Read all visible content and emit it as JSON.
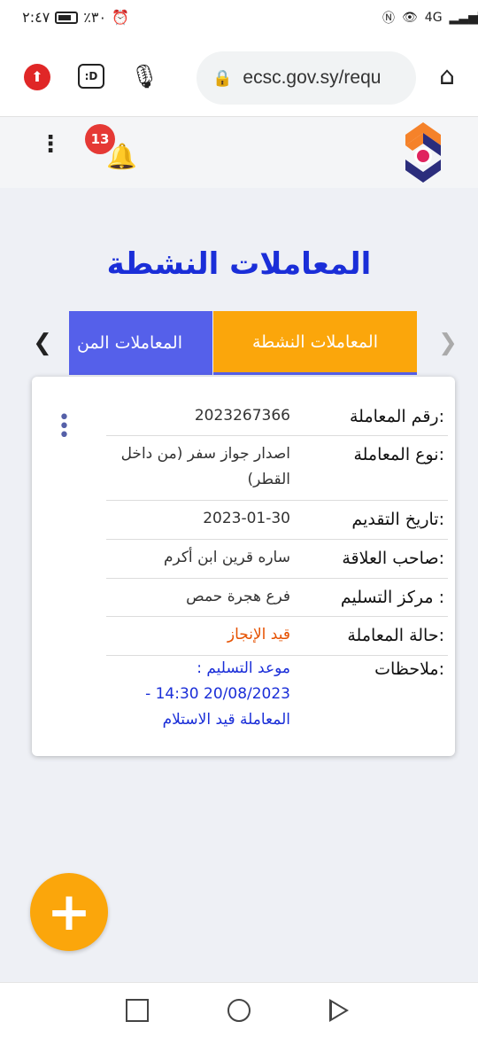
{
  "status_bar": {
    "time": "٢:٤٧",
    "battery": "٪٣٠",
    "network": "4G"
  },
  "browser": {
    "url": "ecsc.gov.sy/requ"
  },
  "header": {
    "notification_count": "13"
  },
  "page": {
    "title": "المعاملات النشطة"
  },
  "tabs": {
    "active_label": "المعاملات النشطة",
    "inactive_label": "المعاملات المن"
  },
  "card": {
    "rows": [
      {
        "label": "رقم المعاملة:",
        "value": "2023267366"
      },
      {
        "label": "نوع المعاملة:",
        "value": "اصدار جواز سفر (من داخل القطر)"
      },
      {
        "label": "تاريخ التقديم:",
        "value": "2023-01-30"
      },
      {
        "label": "صاحب العلاقة:",
        "value": "ساره قرين ابن أكرم"
      },
      {
        "label": "مركز التسليم :",
        "value": "فرع هجرة حمص"
      },
      {
        "label": "حالة المعاملة:",
        "value": "قيد الإنجاز"
      },
      {
        "label": "ملاحظات:",
        "value": "موعد التسليم : 20/08/2023 14:30 - المعاملة قيد الاستلام"
      }
    ]
  },
  "colors": {
    "title_blue": "#1a2ed8",
    "tab_orange": "#fba60b",
    "tab_blue": "#5560ea",
    "status_orange": "#e65100"
  },
  "icons": {
    "fab": "plus-icon",
    "notifications": "bell-icon",
    "menu": "kebab-icon"
  }
}
